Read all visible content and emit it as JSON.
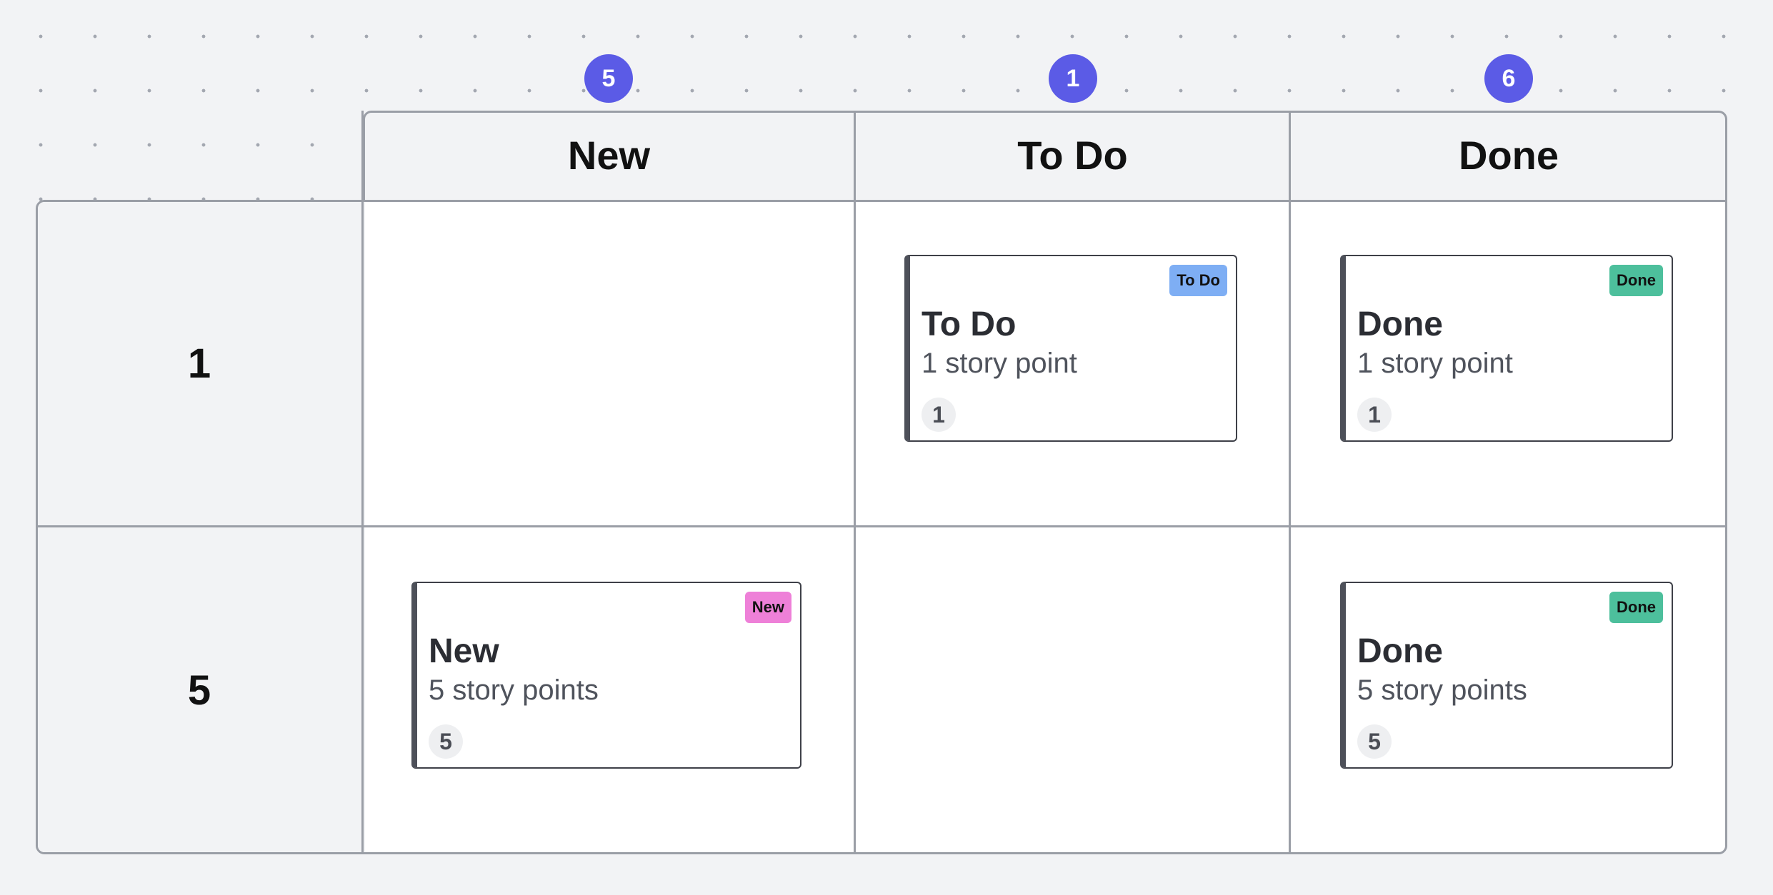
{
  "columns": [
    {
      "title": "New",
      "count": "5"
    },
    {
      "title": "To Do",
      "count": "1"
    },
    {
      "title": "Done",
      "count": "6"
    }
  ],
  "rows": [
    {
      "title": "1"
    },
    {
      "title": "5"
    }
  ],
  "cards": [
    {
      "badge": "To Do",
      "title": "To Do",
      "subtitle": "1 story point",
      "points": "1",
      "badge_color": "#7eaef4"
    },
    {
      "badge": "Done",
      "title": "Done",
      "subtitle": "1 story point",
      "points": "1",
      "badge_color": "#4dbf9c"
    },
    {
      "badge": "New",
      "title": "New",
      "subtitle": "5 story points",
      "points": "5",
      "badge_color": "#ee80d8"
    },
    {
      "badge": "Done",
      "title": "Done",
      "subtitle": "5 story points",
      "points": "5",
      "badge_color": "#4dbf9c"
    }
  ],
  "colors": {
    "count_badge": "#5b5be6",
    "grid_line": "#9a9ea6"
  }
}
